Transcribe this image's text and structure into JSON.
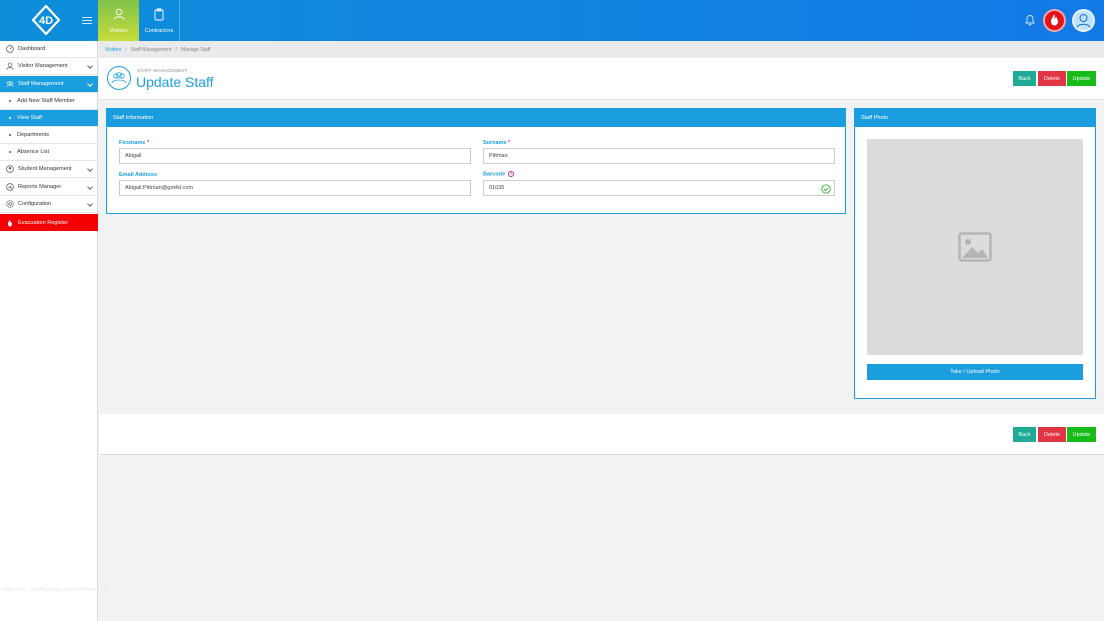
{
  "topbar": {
    "logo_text": "4D",
    "tabs": [
      {
        "label": "Visitors",
        "icon": "visitor-icon",
        "active": true
      },
      {
        "label": "Contractors",
        "icon": "clipboard-icon",
        "active": false
      }
    ],
    "icons": [
      "bell-icon",
      "fire-alert-icon",
      "user-avatar-icon"
    ]
  },
  "sidebar": {
    "items": [
      {
        "label": "Dashboard",
        "icon": "dashboard-icon"
      },
      {
        "label": "Visitor Management",
        "icon": "visitor-icon"
      },
      {
        "label": "Staff Management",
        "icon": "staff-icon"
      },
      {
        "label": "Add New Staff Member"
      },
      {
        "label": "View Staff"
      },
      {
        "label": "Departments"
      },
      {
        "label": "Absence List"
      },
      {
        "label": "Student Management",
        "icon": "student-icon"
      },
      {
        "label": "Reports Manager",
        "icon": "reports-icon"
      },
      {
        "label": "Configuration",
        "icon": "gear-icon"
      },
      {
        "label": "Evacuation Register",
        "icon": "fire-icon"
      }
    ],
    "status_url": "https://4d.../staffmanagement/staff/manage/..."
  },
  "breadcrumb": [
    "Visitors",
    "Staff Management",
    "Manage Staff"
  ],
  "header": {
    "subtitle": "STAFF MANAGEMENT",
    "title": "Update Staff",
    "buttons": {
      "back": "Back",
      "delete": "Delete",
      "update": "Update"
    }
  },
  "staff_info": {
    "heading": "Staff Information",
    "firstname_label": "Firstname",
    "firstname_value": "Abigail",
    "surname_label": "Surname",
    "surname_value": "Pittman",
    "email_label": "Email Address",
    "email_value": "Abigail.Pittman@got4d.com",
    "barcode_label": "Barcode",
    "barcode_value": "01035",
    "required_mark": "*",
    "help_mark": "?"
  },
  "staff_photo": {
    "heading": "Staff Photo",
    "button": "Take / Upload Photo"
  },
  "colors": {
    "primary": "#1b9ee0",
    "back": "#1eaa93",
    "delete": "#e03544",
    "update": "#17bb17",
    "danger": "#f40000"
  }
}
